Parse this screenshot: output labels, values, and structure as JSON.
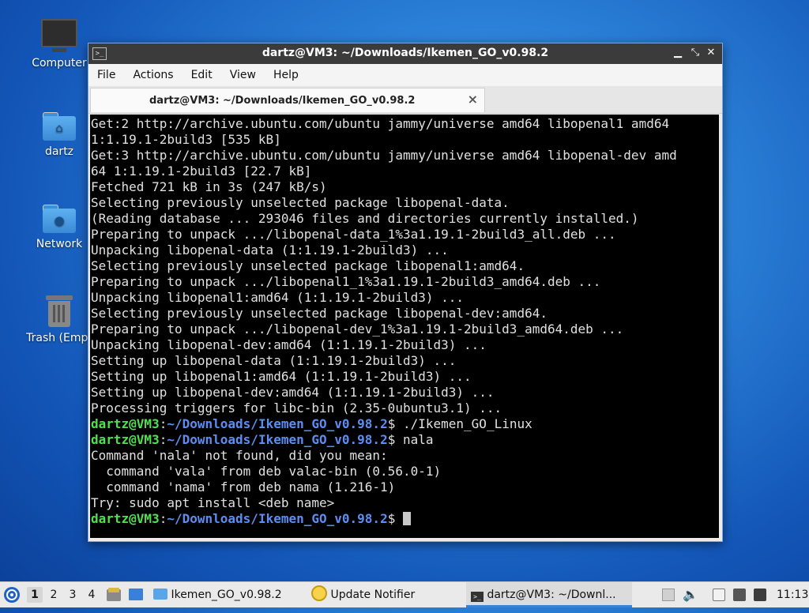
{
  "desktop": {
    "icons": [
      {
        "label": "Computer"
      },
      {
        "label": "dartz"
      },
      {
        "label": "Network"
      },
      {
        "label": "Trash (Empt"
      }
    ]
  },
  "window": {
    "title": "dartz@VM3: ~/Downloads/Ikemen_GO_v0.98.2",
    "menu": [
      "File",
      "Actions",
      "Edit",
      "View",
      "Help"
    ],
    "tab_label": "dartz@VM3: ~/Downloads/Ikemen_GO_v0.98.2",
    "tab_close": "×"
  },
  "terminal": {
    "lines": [
      "Get:2 http://archive.ubuntu.com/ubuntu jammy/universe amd64 libopenal1 amd64",
      "1:1.19.1-2build3 [535 kB]",
      "Get:3 http://archive.ubuntu.com/ubuntu jammy/universe amd64 libopenal-dev amd",
      "64 1:1.19.1-2build3 [22.7 kB]",
      "Fetched 721 kB in 3s (247 kB/s)",
      "Selecting previously unselected package libopenal-data.",
      "(Reading database ... 293046 files and directories currently installed.)",
      "Preparing to unpack .../libopenal-data_1%3a1.19.1-2build3_all.deb ...",
      "Unpacking libopenal-data (1:1.19.1-2build3) ...",
      "Selecting previously unselected package libopenal1:amd64.",
      "Preparing to unpack .../libopenal1_1%3a1.19.1-2build3_amd64.deb ...",
      "Unpacking libopenal1:amd64 (1:1.19.1-2build3) ...",
      "Selecting previously unselected package libopenal-dev:amd64.",
      "Preparing to unpack .../libopenal-dev_1%3a1.19.1-2build3_amd64.deb ...",
      "Unpacking libopenal-dev:amd64 (1:1.19.1-2build3) ...",
      "Setting up libopenal-data (1:1.19.1-2build3) ...",
      "Setting up libopenal1:amd64 (1:1.19.1-2build3) ...",
      "Setting up libopenal-dev:amd64 (1:1.19.1-2build3) ...",
      "Processing triggers for libc-bin (2.35-0ubuntu3.1) ..."
    ],
    "prompt_user": "dartz@VM3",
    "prompt_sep": ":",
    "prompt_path": "~/Downloads/Ikemen_GO_v0.98.2",
    "prompt_char": "$",
    "cmd1": " ./Ikemen_GO_Linux",
    "cmd2": " nala",
    "output": [
      "Command 'nala' not found, did you mean:",
      "  command 'vala' from deb valac-bin (0.56.0-1)",
      "  command 'nama' from deb nama (1.216-1)",
      "Try: sudo apt install <deb name>"
    ]
  },
  "taskbar": {
    "workspaces": [
      "1",
      "2",
      "3",
      "4"
    ],
    "tasks": [
      {
        "label": "Ikemen_GO_v0.98.2"
      },
      {
        "label": "Update Notifier"
      },
      {
        "label": "dartz@VM3: ~/Downl..."
      }
    ],
    "clock": "11:13"
  },
  "colors": {
    "prompt_user": "#4ee04e",
    "prompt_path": "#5c8ef2",
    "accent": "#3b82d6"
  }
}
